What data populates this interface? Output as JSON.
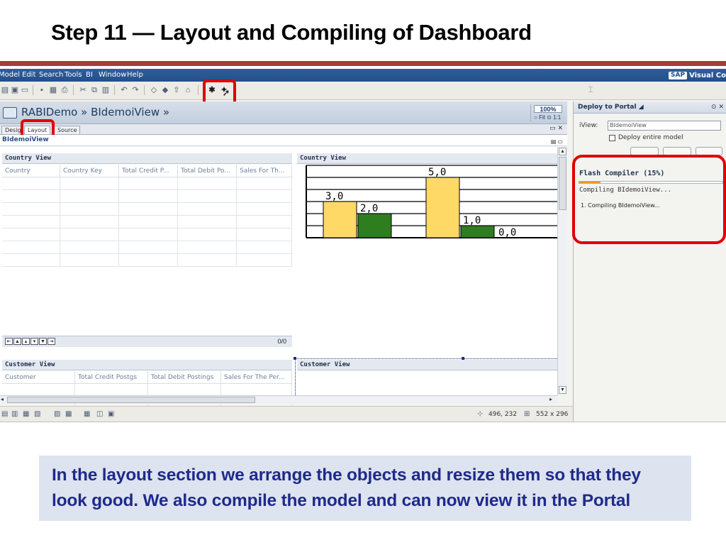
{
  "slide": {
    "title": "Step 11 — Layout and Compiling of Dashboard",
    "caption": "In the layout section we arrange the objects and resize them so that they look good. We also compile the model and can now view it in the Portal"
  },
  "menu": [
    "Model",
    "Edit",
    "Search",
    "Tools",
    "BI",
    "Window",
    "Help"
  ],
  "brand": {
    "sap": "SAP",
    "product": "Visual Co"
  },
  "editor": {
    "title": "RABIDemo » BIdemoiView »",
    "zoom": "100%",
    "fit_label": "Fit",
    "ratio_label": "1:1",
    "tabs": [
      "Design",
      "Layout",
      "Source"
    ],
    "active_tab": "Layout",
    "view_name": "BIdemoiView"
  },
  "country_table": {
    "title": "Country View",
    "columns": [
      "Country",
      "Country Key",
      "Total Credit P...",
      "Total Debit Po...",
      "Sales For Th..."
    ],
    "page_count": "0/0"
  },
  "country_chart": {
    "title": "Country View"
  },
  "chart_data": {
    "type": "bar",
    "series": [
      {
        "values": [
          3.0,
          5.0
        ],
        "color": "#ffd966"
      },
      {
        "values": [
          2.0,
          1.0,
          0.0
        ],
        "color": "#2e7d1e"
      }
    ],
    "bars": [
      {
        "series": 0,
        "value": 3.0,
        "label": "3,0"
      },
      {
        "series": 1,
        "value": 2.0,
        "label": "2,0"
      },
      {
        "series": 0,
        "value": 5.0,
        "label": "5,0"
      },
      {
        "series": 1,
        "value": 1.0,
        "label": "1,0"
      },
      {
        "series": 1,
        "value": 0.0,
        "label": "0,0"
      }
    ],
    "ylim": [
      0,
      6
    ],
    "grid": true
  },
  "customer_table": {
    "title": "Customer View",
    "columns": [
      "Customer",
      "Total Credit Postgs",
      "Total Debit Postings",
      "Sales For The Per..."
    ]
  },
  "customer_chart": {
    "title": "Customer View"
  },
  "status": {
    "position": "496, 232",
    "size": "552 x 296"
  },
  "deploy_panel": {
    "title": "Deploy to Portal",
    "iview_label": "iView:",
    "iview_value": "BIdemoiView",
    "deploy_entire_label": "Deploy entire model",
    "compiler_title": "Flash Compiler (15%)",
    "progress": 0.15,
    "compiler_status": "Compiling BIdemoiView...",
    "step": "1. Compiling BIdemoiView..."
  },
  "colors": {
    "title_rule": "#a33d35",
    "highlight": "#e00000",
    "caption_text": "#1f2a8c",
    "caption_bg": "#dde3ef"
  }
}
